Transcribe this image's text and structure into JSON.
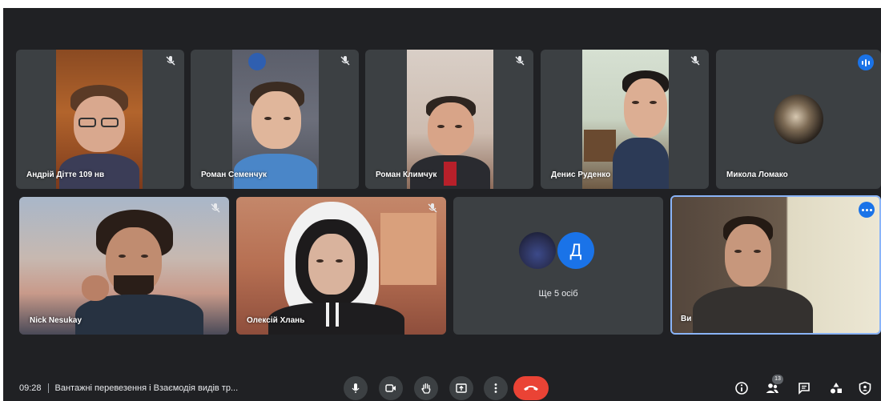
{
  "participants": [
    {
      "name": "Андрій Дітте 109 нв",
      "muted": true
    },
    {
      "name": "Роман Семенчук",
      "muted": true
    },
    {
      "name": "Роман Климчук",
      "muted": true
    },
    {
      "name": "Денис Руденко",
      "muted": true
    },
    {
      "name": "Микола Ломако",
      "speaking": true
    },
    {
      "name": "Nick Nesukay",
      "muted": true
    },
    {
      "name": "Олексій Хлань",
      "muted": true
    },
    {
      "name": "Ви",
      "self": true
    }
  ],
  "more_tile": {
    "label": "Ще 5 осіб",
    "avatar_letter": "Д",
    "avatar_color": "#1a73e8"
  },
  "meeting": {
    "time": "09:28",
    "title": "Вантажні перевезення і Взаємодія видів тр..."
  },
  "controls": [
    "mic",
    "camera",
    "raise-hand",
    "present",
    "more-options",
    "leave-call"
  ],
  "right_controls": [
    "info",
    "people",
    "chat",
    "activities",
    "host-controls"
  ],
  "people_count": "13",
  "colors": {
    "background": "#202124",
    "tile": "#3c4043",
    "accent": "#1a73e8",
    "hangup": "#ea4335",
    "active_border": "#8ab4f8"
  }
}
